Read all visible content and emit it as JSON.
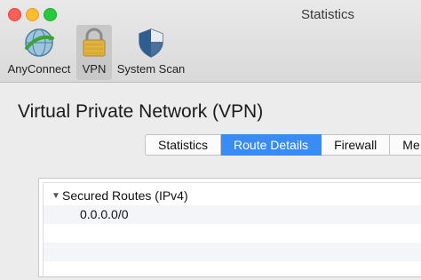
{
  "window": {
    "title": "Statistics"
  },
  "toolbar": {
    "items": [
      {
        "label": "AnyConnect",
        "icon": "anyconnect-globe-icon"
      },
      {
        "label": "VPN",
        "icon": "padlock-icon"
      },
      {
        "label": "System Scan",
        "icon": "shield-icon"
      }
    ],
    "selected": "VPN"
  },
  "main": {
    "heading": "Virtual Private Network (VPN)",
    "tabs": [
      {
        "label": "Statistics",
        "active": false
      },
      {
        "label": "Route Details",
        "active": true
      },
      {
        "label": "Firewall",
        "active": false
      },
      {
        "label": "Me",
        "active": false
      }
    ],
    "routes": {
      "group_label": "Secured Routes (IPv4)",
      "entries": [
        "0.0.0.0/0"
      ]
    }
  },
  "colors": {
    "accent": "#3a8cf4",
    "close": "#fc5f57",
    "minimize": "#fdbc2e",
    "maximize": "#28c840"
  }
}
